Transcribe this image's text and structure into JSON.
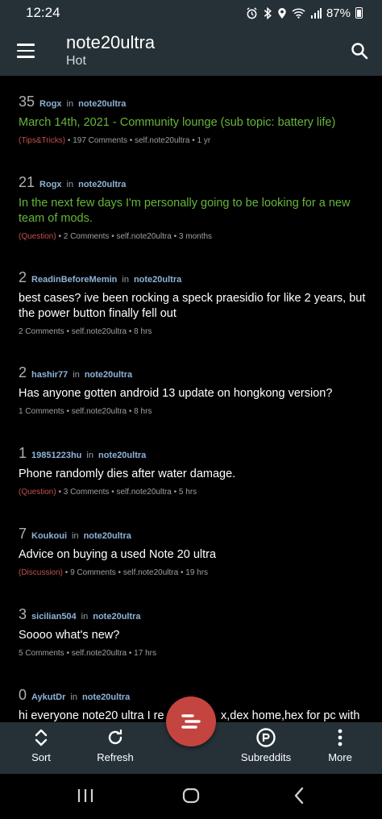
{
  "status": {
    "time": "12:24",
    "battery": "87%"
  },
  "app_bar": {
    "title": "note20ultra",
    "subtitle": "Hot"
  },
  "posts": [
    {
      "score": "35",
      "author": "Rogx",
      "in_word": "in",
      "subreddit": "note20ultra",
      "title": "March 14th, 2021 - Community lounge (sub topic: battery life)",
      "flair": "(Tips&Tricks)",
      "info": " • 197 Comments • self.note20ultra • 1 yr"
    },
    {
      "score": "21",
      "author": "Rogx",
      "in_word": "in",
      "subreddit": "note20ultra",
      "title": "In the next few days I'm personally going to be looking for a new team of mods.",
      "flair": "(Question)",
      "info": " • 2 Comments • self.note20ultra • 3 months"
    },
    {
      "score": "2",
      "author": "ReadinBeforeMemin",
      "in_word": "in",
      "subreddit": "note20ultra",
      "title": "best cases? ive been rocking a speck praesidio for like 2 years, but the power button finally fell out",
      "flair": "",
      "info": "2 Comments • self.note20ultra • 8 hrs"
    },
    {
      "score": "2",
      "author": "hashir77",
      "in_word": "in",
      "subreddit": "note20ultra",
      "title": "Has anyone gotten android 13 update on hongkong version?",
      "flair": "",
      "info": "1 Comments • self.note20ultra • 8 hrs"
    },
    {
      "score": "1",
      "author": "19851223hu",
      "in_word": "in",
      "subreddit": "note20ultra",
      "title": "Phone randomly dies after water damage.",
      "flair": "(Question)",
      "info": " • 3 Comments • self.note20ultra • 5 hrs"
    },
    {
      "score": "7",
      "author": "Koukoui",
      "in_word": "in",
      "subreddit": "note20ultra",
      "title": "Advice on buying a used Note 20 ultra",
      "flair": "(Discussion)",
      "info": " • 9 Comments • self.note20ultra • 19 hrs"
    },
    {
      "score": "3",
      "author": "sicilian504",
      "in_word": "in",
      "subreddit": "note20ultra",
      "title": "Soooo what's new?",
      "flair": "",
      "info": "5 Comments • self.note20ultra • 17 hrs"
    },
    {
      "score": "0",
      "author": "AykutDr",
      "in_word": "in",
      "subreddit": "note20ultra",
      "title": "hi everyone note20 ultra I re",
      "title_tail": "x,dex home,hex for pc with",
      "flair": "",
      "info": ""
    }
  ],
  "bottom_nav": {
    "sort": "Sort",
    "refresh": "Refresh",
    "subreddits": "Subreddits",
    "more": "More"
  },
  "colors": {
    "bar": "#263137",
    "fab": "#c4443f",
    "green_title": "#67b53a",
    "flair": "#c0504d"
  }
}
